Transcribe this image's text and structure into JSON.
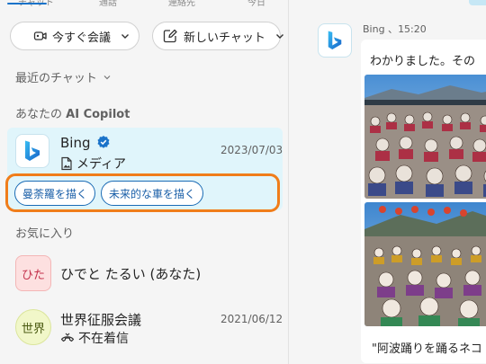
{
  "top_tabs": [
    "チャット",
    "通話",
    "連絡先",
    "今日"
  ],
  "actions": {
    "meet_now": "今すぐ会議",
    "new_chat": "新しいチャット"
  },
  "recent_chats_label": "最近のチャット",
  "copilot_section": {
    "prefix": "あなたの",
    "bold": "AI Copilot"
  },
  "bing_chat": {
    "name": "Bing",
    "subtitle": "メディア",
    "date": "2023/07/03",
    "suggestions": [
      "曼荼羅を描く",
      "未来的な車を描く"
    ]
  },
  "favorites_label": "お気に入り",
  "favorites": [
    {
      "avatar_text": "ひた",
      "name": "ひでと たるい (あなた)"
    },
    {
      "avatar_text": "世界",
      "name": "世界征服会議",
      "subtitle": "不在着信",
      "date": "2021/06/12"
    }
  ],
  "conversation": {
    "sender": "Bing",
    "time": "15:20",
    "text": "わかりました。その",
    "caption": "\"阿波踊りを踊るネコ"
  },
  "colors": {
    "accent": "#1a73c9",
    "card_bg": "#e0f5fb",
    "highlight": "#f07d1a",
    "hito_avatar_bg": "#fde0e0",
    "sekai_avatar_bg": "#f1f7c9"
  },
  "icons": [
    "video-camera-icon",
    "chevron-down-icon",
    "compose-icon",
    "bing-logo-icon",
    "verified-badge-icon",
    "media-file-icon",
    "missed-call-icon"
  ]
}
